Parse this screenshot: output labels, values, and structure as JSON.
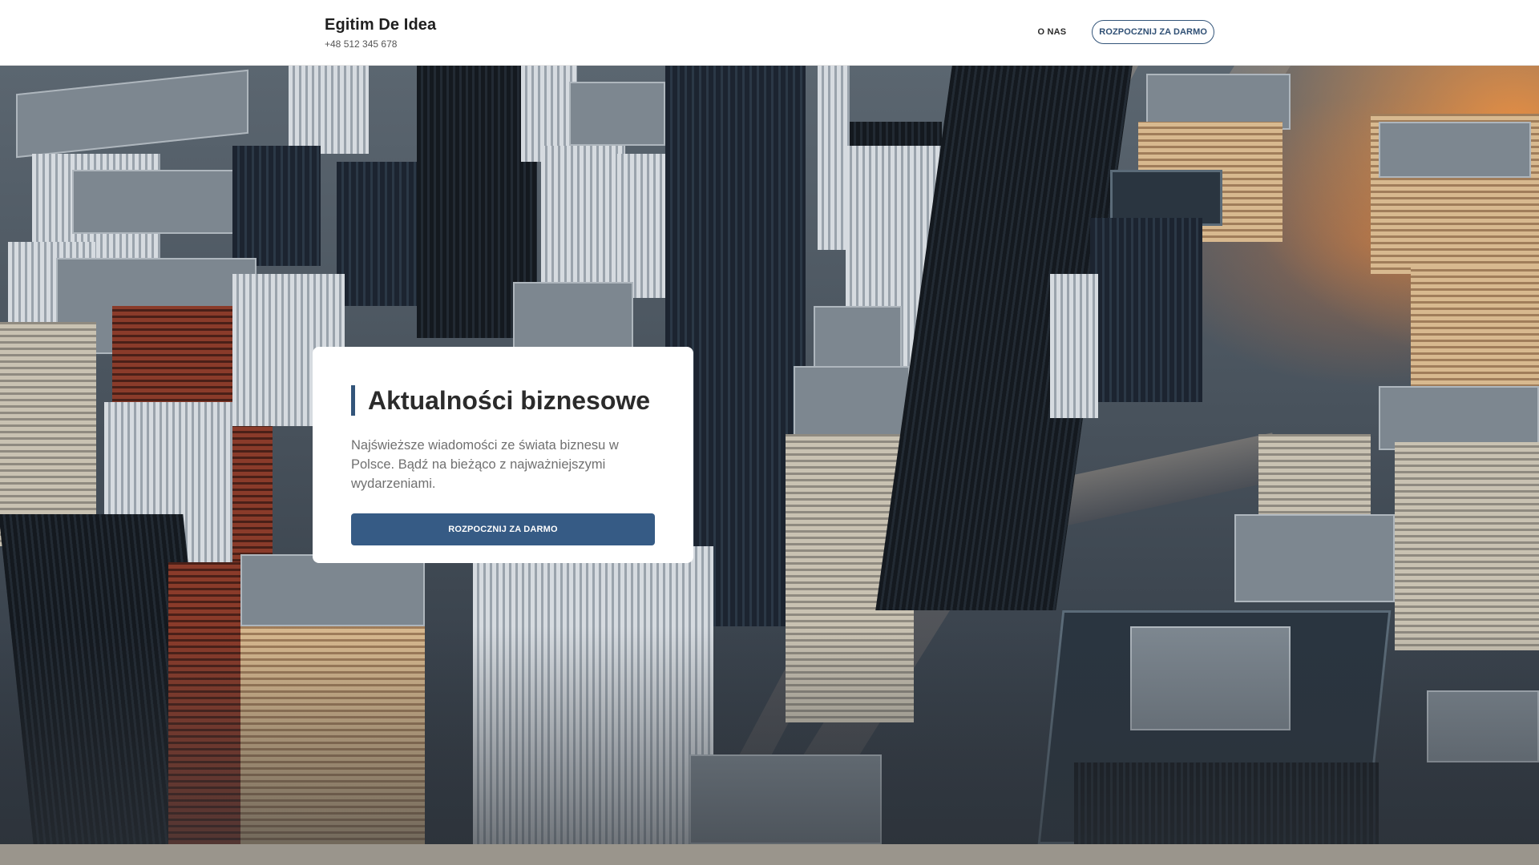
{
  "header": {
    "brand_title": "Egitim De Idea",
    "phone": "+48 512 345 678",
    "nav": {
      "about_label": "O NAS",
      "cta_label": "ROZPOCZNIJ ZA DARMO"
    }
  },
  "hero": {
    "background_image": "aerial-city-skyline-photo",
    "card": {
      "title": "Aktualności biznesowe",
      "description": "Najświeższe wiadomości ze świata biznesu w Polsce. Bądź na bieżąco z najważniejszymi wydarzeniami.",
      "cta_label": "ROZPOCZNIJ ZA DARMO"
    }
  },
  "colors": {
    "accent": "#365b85",
    "accent_border": "#33557a",
    "bottom_strip": "#9a958c"
  }
}
